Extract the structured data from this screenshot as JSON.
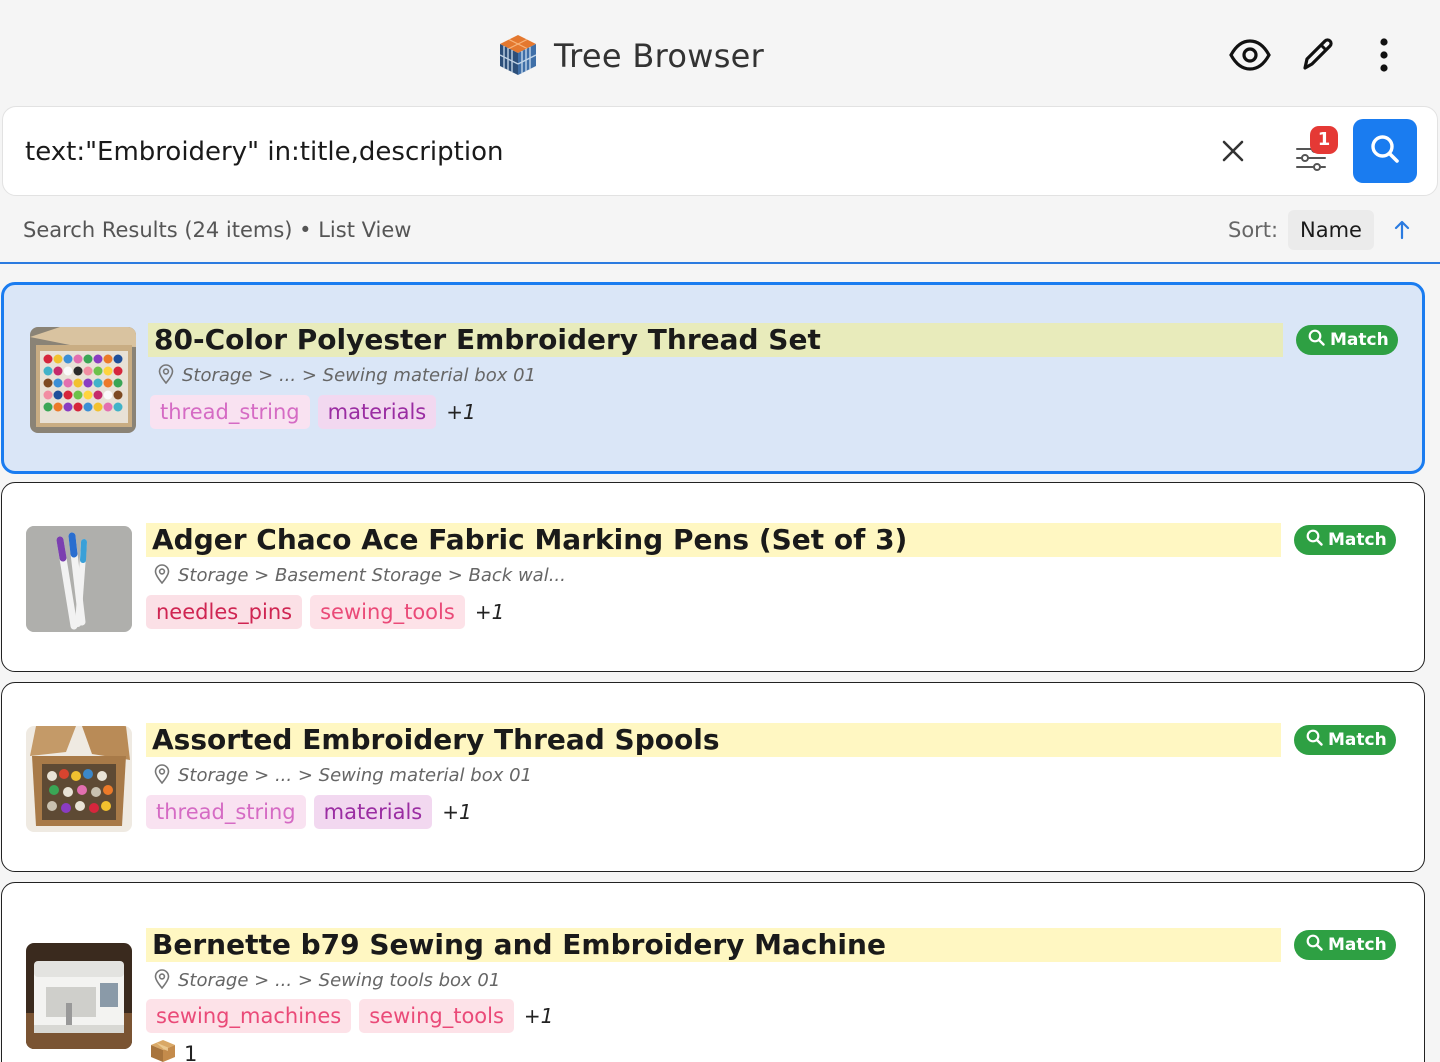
{
  "header": {
    "title": "Tree Browser",
    "icons": [
      "tree-browser-logo",
      "eye-icon",
      "pencil-icon",
      "more-vertical-icon"
    ]
  },
  "search": {
    "query": "text:\"Embroidery\" in:title,description",
    "filter_count": "1",
    "icons": [
      "close-icon",
      "filter-sliders-icon",
      "search-icon"
    ],
    "accent_color": "#1a7cf0"
  },
  "results": {
    "summary": "Search Results (24 items) • List View",
    "sort_label": "Sort:",
    "sort_value": "Name",
    "sort_direction": "ascending"
  },
  "items": [
    {
      "title": "80-Color Polyester Embroidery Thread Set",
      "path": "Storage > ... > Sewing material box 01",
      "tags": [
        "thread_string",
        "materials"
      ],
      "more": "+1",
      "match": "Match",
      "selected": true
    },
    {
      "title": "Adger Chaco Ace Fabric Marking Pens (Set of 3)",
      "path": "Storage > Basement Storage > Back wal...",
      "tags": [
        "needles_pins",
        "sewing_tools"
      ],
      "more": "+1",
      "match": "Match",
      "selected": false
    },
    {
      "title": "Assorted Embroidery Thread Spools",
      "path": "Storage > ... > Sewing material box 01",
      "tags": [
        "thread_string",
        "materials"
      ],
      "more": "+1",
      "match": "Match",
      "selected": false
    },
    {
      "title": "Bernette b79 Sewing and Embroidery Machine",
      "path": "Storage > ... > Sewing tools box 01",
      "tags": [
        "sewing_machines",
        "sewing_tools"
      ],
      "more": "+1",
      "match": "Match",
      "quantity": "1",
      "selected": false
    }
  ],
  "colors": {
    "selected_bg": "#dae6f7",
    "highlight": "#fff7c2",
    "match_green": "#2ea043"
  }
}
